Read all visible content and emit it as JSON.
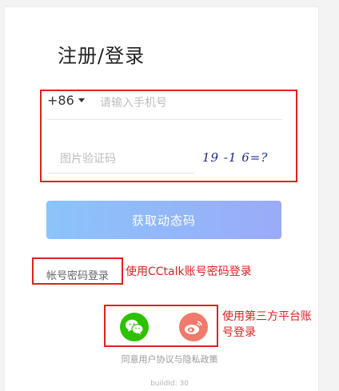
{
  "page_title": "注册/登录",
  "phone": {
    "country_code": "+86",
    "placeholder": "请输入手机号",
    "value": ""
  },
  "captcha": {
    "placeholder": "图片验证码",
    "value": "",
    "image_text": "19 -1 6=?"
  },
  "otp_button_label": "获取动态码",
  "password_login_label": "帐号密码登录",
  "annotations": {
    "password_login": "使用CCtalk账号密码登录",
    "social_login_line1": "使用第三方平台账",
    "social_login_line2": "号登录"
  },
  "social_icons": [
    "wechat-icon",
    "weibo-icon"
  ],
  "agreement": {
    "prefix": "同意",
    "user_agreement": "用户协议",
    "conjunction": "与",
    "privacy_policy": "隐私政策"
  },
  "build_id": "buildId: 30",
  "colors": {
    "annotation_red": "#e02020",
    "button_gradient_start": "#8bc4fb",
    "button_gradient_end": "#9aabf7",
    "wechat_green": "#2dc100",
    "weibo_coral": "#f07a6b"
  }
}
